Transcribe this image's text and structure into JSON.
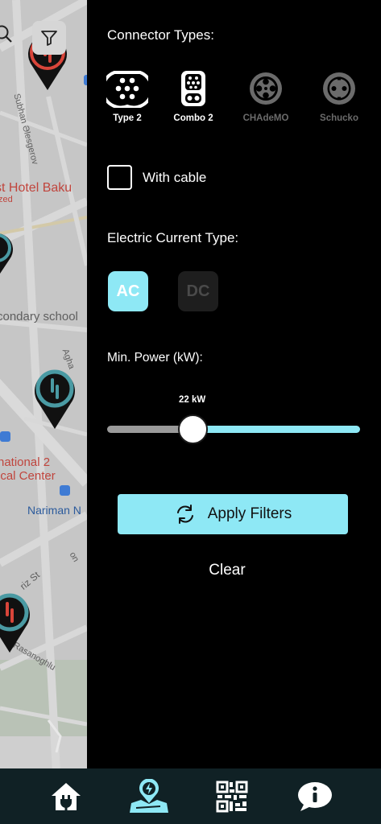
{
  "map": {
    "labels": {
      "hotel": "st Hotel Baku",
      "hotel_sub": "zed",
      "school": "condary school",
      "national": "national 2",
      "center": "ical Center",
      "nariman": "Nariman N",
      "street_subhan": "Subhan Əlesgerov",
      "street_agha": "Agha",
      "street_tebriz": "riz St",
      "street_rasan": "Rasanoghlu",
      "street_on": "on"
    },
    "icons": {
      "search": "search-icon",
      "filter": "filter-icon",
      "pin": "charging-station-pin-icon",
      "bus": "bus-stop-icon"
    }
  },
  "filters": {
    "connector_title": "Connector Types:",
    "connectors": [
      {
        "label": "Type 2",
        "icon": "type2-connector-icon",
        "active": true
      },
      {
        "label": "Combo 2",
        "icon": "combo2-connector-icon",
        "active": true
      },
      {
        "label": "CHAdeMO",
        "icon": "chademo-connector-icon",
        "active": false
      },
      {
        "label": "Schucko",
        "icon": "schuko-connector-icon",
        "active": false
      }
    ],
    "with_cable_label": "With cable",
    "with_cable_checked": false,
    "current_title": "Electric Current Type:",
    "current_options": [
      {
        "label": "AC",
        "selected": true
      },
      {
        "label": "DC",
        "selected": false
      }
    ],
    "power_title": "Min. Power (kW):",
    "power_value_label": "22 kW",
    "power_value": 22,
    "apply_label": "Apply Filters",
    "clear_label": "Clear"
  },
  "nav": {
    "items": [
      {
        "icon": "home-plug-icon"
      },
      {
        "icon": "map-charging-icon"
      },
      {
        "icon": "qr-code-icon"
      },
      {
        "icon": "info-bubble-icon"
      }
    ]
  },
  "colors": {
    "accent": "#8ee8f5",
    "panel_bg": "#000000",
    "nav_bg": "#102125",
    "map_bg": "#c8c8c8",
    "pin_accent": "#4a9aa3",
    "pin_alt": "#d9453a"
  }
}
